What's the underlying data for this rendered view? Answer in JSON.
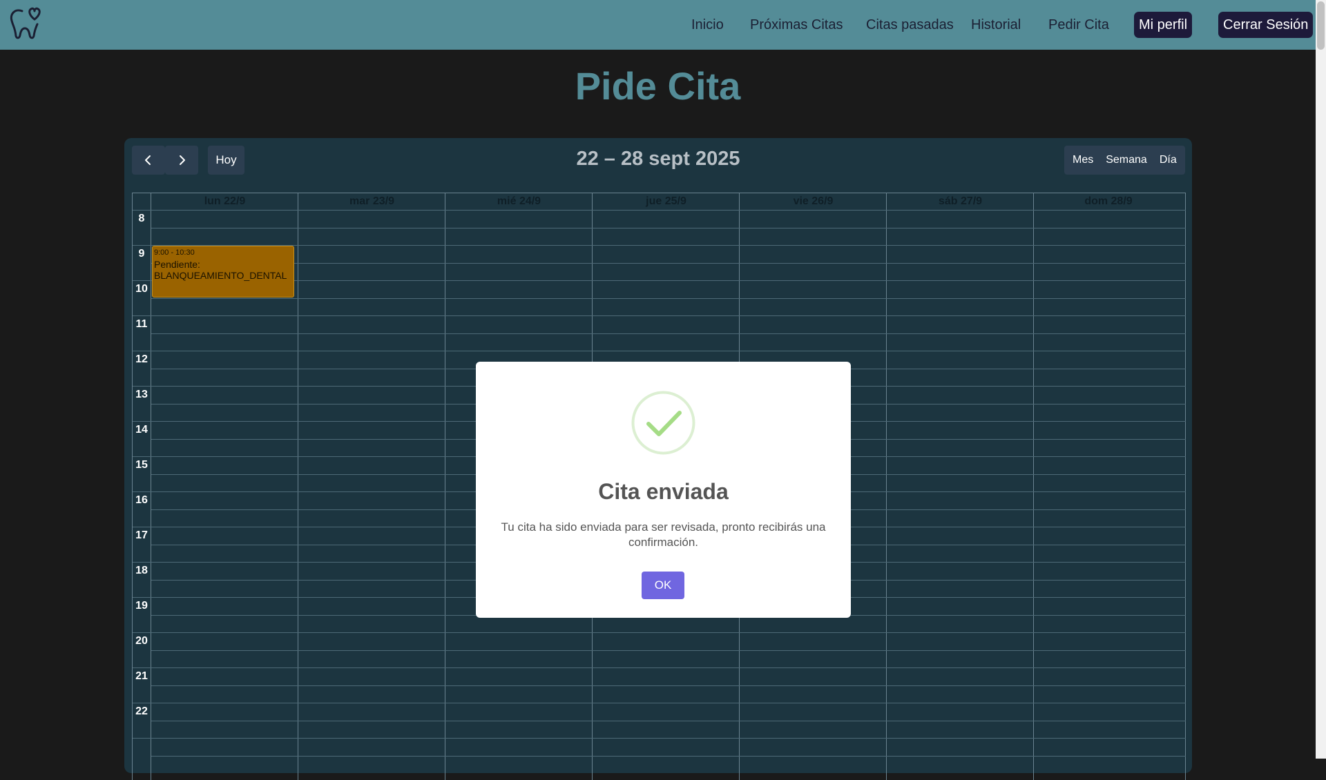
{
  "nav": {
    "links": [
      "Inicio",
      "Próximas Citas",
      "Citas pasadas",
      "Historial",
      "Pedir Cita"
    ],
    "profile_label": "Mi perfil",
    "logout_label": "Cerrar Sesión",
    "logo_icon": "tooth-logo-icon",
    "bar_color": "#548c97"
  },
  "page": {
    "title": "Pide Cita"
  },
  "calendar": {
    "prev_icon": "chevron-left-icon",
    "next_icon": "chevron-right-icon",
    "today_label": "Hoy",
    "range_title": "22 – 28 sept 2025",
    "views": [
      "Mes",
      "Semana",
      "Día"
    ],
    "days": [
      "lun 22/9",
      "mar 23/9",
      "mié 24/9",
      "jue 25/9",
      "vie 26/9",
      "sáb 27/9",
      "dom 28/9"
    ],
    "hours": [
      "8",
      "9",
      "10",
      "11",
      "12",
      "13",
      "14",
      "15",
      "16",
      "17",
      "18",
      "19",
      "20",
      "21",
      "22"
    ],
    "event": {
      "time": "9:00 - 10:30",
      "status": "Pendiente:",
      "service": "BLANQUEAMIENTO_DENTAL",
      "color": "#9a6300"
    }
  },
  "modal": {
    "icon": "success-check-icon",
    "title": "Cita enviada",
    "text": "Tu cita ha sido enviada para ser revisada, pronto recibirás una confirmación.",
    "ok_label": "OK",
    "ok_color": "#7066e0"
  }
}
